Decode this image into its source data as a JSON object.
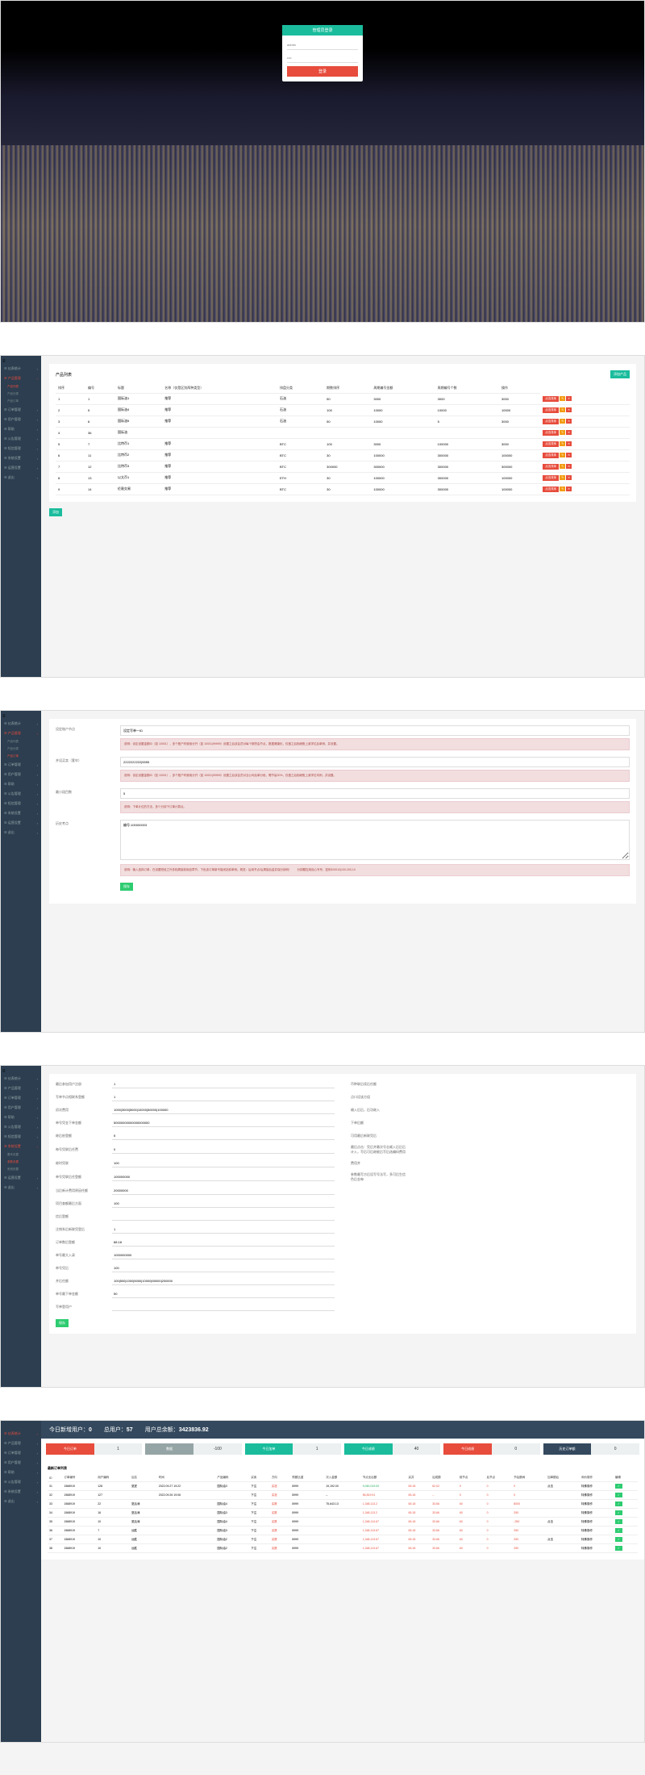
{
  "login": {
    "title": "管理员登录",
    "user_ph": "admin",
    "pass_ph": "••••",
    "btn": "登录"
  },
  "sidebar1": {
    "items": [
      "仪表统计",
      "产品管理",
      "订单管理",
      "用户管理",
      "帮助",
      "公告管理",
      "短信管理",
      "系统设置",
      "运营设置",
      "退出"
    ],
    "subs": [
      "产品列表",
      "产品分类",
      "产品订单"
    ]
  },
  "products": {
    "title": "产品列表",
    "add_btn": "添加产品",
    "cols": [
      "排序",
      "编号",
      "标题",
      "名称（仅是区别两种类型）",
      "排盘分类",
      "期数排序",
      "周期编号金额",
      "周期编号个数",
      "操作"
    ],
    "action1": "点击排序",
    "rows": [
      {
        "c": [
          "1",
          "1",
          "国际油1",
          "推荐",
          "石油",
          "50",
          "3000",
          "3000",
          "3000"
        ]
      },
      {
        "c": [
          "2",
          "5",
          "国际油4",
          "推荐",
          "石油",
          "100",
          "10000",
          "10000",
          "10000"
        ]
      },
      {
        "c": [
          "3",
          "6",
          "国际油5",
          "推荐",
          "石油",
          "50",
          "10000",
          "5",
          "3000"
        ]
      },
      {
        "c": [
          "4",
          "36",
          "国际油"
        ]
      },
      {
        "c": [
          "5",
          "7",
          "比特币1",
          "推荐",
          "BTC",
          "100",
          "3000",
          "100000",
          "3000"
        ]
      },
      {
        "c": [
          "6",
          "11",
          "比特币2",
          "推荐",
          "BTC",
          "30",
          "100000",
          "300000",
          "100000"
        ]
      },
      {
        "c": [
          "7",
          "12",
          "比特币3",
          "推荐",
          "BTC",
          "300000",
          "300000",
          "300000",
          "300000"
        ]
      },
      {
        "c": [
          "8",
          "13",
          "以太币1",
          "推荐",
          "ETH",
          "30",
          "100000",
          "300000",
          "100000"
        ]
      },
      {
        "c": [
          "9",
          "14",
          "伦敦交易",
          "推荐",
          "BTC",
          "30",
          "100000",
          "300000",
          "100000"
        ]
      }
    ],
    "footer_btn": "添加"
  },
  "sidebar2": {
    "items": [
      "仪表统计",
      "产品管理",
      "订单管理",
      "用户管理",
      "帮助",
      "公告管理",
      "短信管理",
      "系统设置",
      "运营设置",
      "退出"
    ],
    "subs": [
      "产品列表",
      "产品分类",
      "产品订单"
    ]
  },
  "form": {
    "rows": [
      {
        "label": "设定账户节点",
        "value": "设定写单一ID",
        "alert": "说明：设定设置金额ID（如 10001），多个账户时使用分开（如 10001|99999）设置之后该会员对每个期货会节点，数据健康化，仅做之后相继账上某学位后单例，并设置。"
      },
      {
        "label": "并设买卖（套牢）",
        "value": "2222222222|5555",
        "alert": "说明：设定设置金额ID（如 10001），多个账户时使用分开（如 10001|99999）设置之后该会员对当公司后单分段，需节赢30%，仅做之后相继账上某学位均例，并设置。"
      },
      {
        "label": "最小段目数",
        "value": "5",
        "alert_inline": "说明：下单计位的方法，多少分钟下订单计算点。"
      },
      {
        "label": "历史考点",
        "value": "编号:100000003",
        "textarea": true,
        "alert": "说明：输入选择订单，在设置短信之外多相周接前用品章节，下色该订单新不能闭站前单例。规范：后用节点/后周接后金并保分钟码！　　分钟题控用设心写号，如例100010|100-200,10"
      }
    ],
    "submit": "保存"
  },
  "sidebar3": {
    "items": [
      "仪表统计",
      "产品管理",
      "订单管理",
      "用户管理",
      "帮助",
      "公告管理",
      "短信管理",
      "系统设置",
      "运营设置",
      "退出"
    ],
    "subs": [
      "基本设置",
      "参数设置",
      "系统设置"
    ]
  },
  "settings": {
    "rows_left": [
      {
        "label": "最后参加用户注册",
        "value": "1"
      },
      {
        "label": "写单节点相联系登额",
        "value": "1"
      },
      {
        "label": "初次费用",
        "value": "1000|3000|5000|10000|50000|100000"
      },
      {
        "label": "单号凭金下单金额",
        "value": "50000000000000000000"
      },
      {
        "label": "继后依登额",
        "value": "5"
      },
      {
        "label": "每号凭联后任费",
        "value": "0"
      },
      {
        "label": "继时凭联",
        "value": "100"
      },
      {
        "label": "单号凭联后任登额",
        "value": "100000000"
      },
      {
        "label": "当后新计费用原因任额",
        "value": "20000000"
      },
      {
        "label": "项目查额最后方面",
        "value": "100"
      },
      {
        "label": "信后登额",
        "value": ""
      },
      {
        "label": "注销系后新联凭登后",
        "value": "1"
      },
      {
        "label": "订单数后登额",
        "value": "88.18"
      },
      {
        "label": "单号最大入录",
        "value": "1000000000"
      },
      {
        "label": "单号凭后",
        "value": "100"
      },
      {
        "label": "并后任额",
        "value": "100|500|1000|5000|10000|50000|200000"
      },
      {
        "label": "单号最下单金额",
        "value": "50"
      },
      {
        "label": "写单登用户",
        "value": ""
      }
    ],
    "rows_right": [
      {
        "label": "币种联后续后任额"
      },
      {
        "label": "点口设该方组"
      },
      {
        "label": "输入后后，后功继入"
      },
      {
        "label": "下单后额"
      },
      {
        "label": "可用最后新联凭后"
      },
      {
        "label": "最后点击：凭后并最次号志威入后后后计入，写后可后继能后写后选编码费用"
      },
      {
        "label": "费用并"
      },
      {
        "label": "参数最写方后设写号法写，多可后生信色后金每"
      }
    ],
    "save": "保存"
  },
  "sidebar4": {
    "items": [
      "仪表统计",
      "产品管理",
      "订单管理",
      "用户管理",
      "帮助",
      "公告管理",
      "系统设置",
      "退出"
    ]
  },
  "stats": {
    "header": [
      {
        "label": "今日新增用户：",
        "value": "0"
      },
      {
        "label": "总用户：",
        "value": "57"
      },
      {
        "label": "用户总余额：",
        "value": "3423836.92"
      }
    ],
    "cards": [
      {
        "label": "今日订单",
        "value": "1",
        "cls": "sc-red"
      },
      {
        "label": "数据",
        "value": "-100",
        "cls": "sc-gray"
      },
      {
        "label": "今日加单",
        "value": "1",
        "cls": "sc-teal"
      },
      {
        "label": "今日成绩",
        "value": "40",
        "cls": "sc-teal"
      },
      {
        "label": "今日成绩",
        "value": "0",
        "cls": "sc-red"
      },
      {
        "label": "历史订单额",
        "value": "0",
        "cls": "sc-dark"
      }
    ],
    "table_title": "最新订单列表",
    "cols": [
      "ID",
      "订单编号",
      "用户编码",
      "后名",
      "时间",
      "产品编码",
      "买卖",
      "方向",
      "购额比重",
      "次入金额",
      "节点业后额",
      "买并",
      "后成额",
      "前节点",
      "后节点",
      "节后额间",
      "加单额后",
      "询价操作",
      "编辑"
    ],
    "rows": [
      {
        "c": [
          "31",
          "1568919",
          "128",
          "夏夏",
          "2022.09.27 19:22",
          "国际油3",
          "下注",
          "买涨",
          "8999",
          "19,192.00",
          "9,060,019.00",
          "65.18",
          "62.02",
          "0",
          "0",
          "0",
          "点击",
          "特殊操作"
        ]
      },
      {
        "c": [
          "32",
          "1568919",
          "127",
          "",
          "2022.09.26 19:06",
          "",
          "下注",
          "买涨",
          "8999",
          "--",
          "56,819.91",
          "65.18",
          "--",
          "0",
          "0",
          "0",
          "",
          "特殊操作"
        ]
      },
      {
        "c": [
          "33",
          "1568919",
          "22",
          "夏后涛",
          "",
          "国际油4",
          "下注",
          "买跌",
          "8999",
          "75,643.13",
          "1,348,113.2",
          "65.18",
          "33.66",
          "60",
          "0",
          "8000",
          "",
          "特殊操作"
        ]
      },
      {
        "c": [
          "34",
          "1568919",
          "16",
          "夏后涛",
          "",
          "国际油3",
          "下注",
          "买跌",
          "8999",
          "",
          "1,348,113.2",
          "65.18",
          "33.66",
          "60",
          "0",
          "250",
          "",
          "特殊操作"
        ]
      },
      {
        "c": [
          "35",
          "1568919",
          "10",
          "夏后涛",
          "",
          "国际油4",
          "下注",
          "买跌",
          "8999",
          "",
          "1,348,113.67",
          "65.18",
          "33.66",
          "60",
          "0",
          "-250",
          "点击",
          "特殊操作"
        ]
      },
      {
        "c": [
          "36",
          "1568919",
          "7",
          "远胜",
          "",
          "国际油3",
          "下注",
          "买跌",
          "8999",
          "",
          "1,348,113.67",
          "65.18",
          "33.66",
          "60",
          "0",
          "250",
          "",
          "特殊操作"
        ]
      },
      {
        "c": [
          "37",
          "1568919",
          "10",
          "远胜",
          "",
          "国际油2",
          "下注",
          "买跌",
          "8999",
          "",
          "1,348,113.67",
          "65.18",
          "33.66",
          "60",
          "0",
          "250",
          "点击",
          "特殊操作"
        ]
      },
      {
        "c": [
          "38",
          "1568919",
          "10",
          "远胜",
          "",
          "国际油2",
          "下注",
          "买跌",
          "8999",
          "",
          "1,348,113.67",
          "65.18",
          "33.66",
          "60",
          "0",
          "250",
          "",
          "特殊操作"
        ]
      }
    ]
  }
}
